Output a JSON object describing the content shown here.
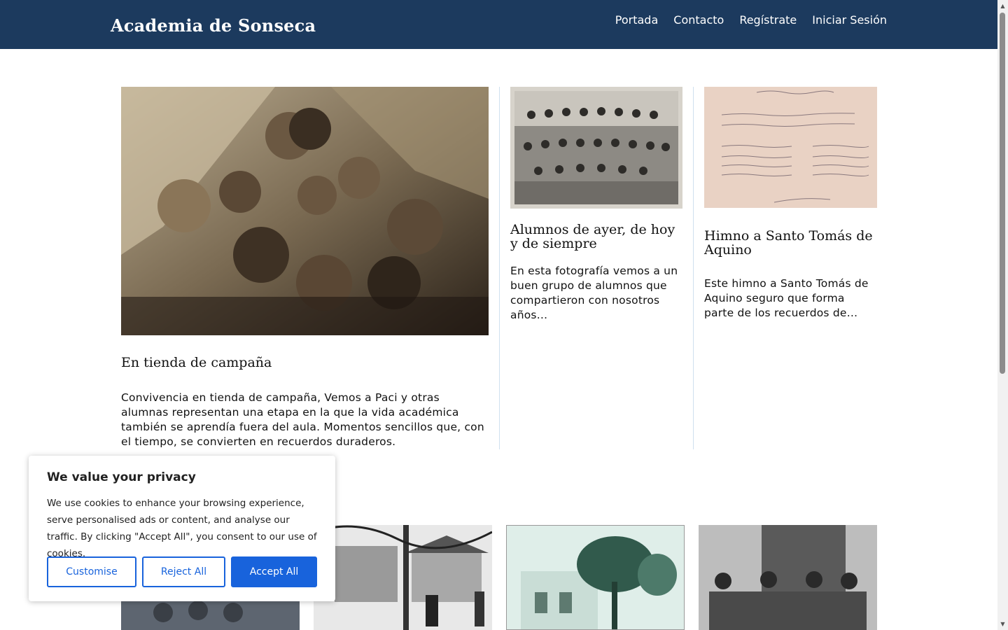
{
  "header": {
    "brand": "Academia de Sonseca",
    "nav": [
      "Portada",
      "Contacto",
      "Regístrate",
      "Iniciar Sesión"
    ]
  },
  "featured": [
    {
      "title": "En tienda de campaña",
      "excerpt": "Convivencia en tienda de campaña, Vemos a Paci y otras alumnas representan una etapa en la que la vida académica también se aprendía fuera del aula. Momentos sencillos que, con el tiempo, se convierten en recuerdos duraderos."
    },
    {
      "title": "Alumnos de ayer, de hoy y de siempre",
      "excerpt": "En esta fotografía vemos a un buen grupo de alumnos que compartieron con nosotros años…"
    },
    {
      "title": "Himno a Santo Tomás de Aquino",
      "excerpt": "Este himno a Santo Tomás de Aquino seguro que forma parte de los recuerdos de…"
    }
  ],
  "cookie": {
    "title": "We value your privacy",
    "text": "We use cookies to enhance your browsing experience, serve personalised ads or content, and analyse our traffic. By clicking \"Accept All\", you consent to our use of cookies.",
    "customise": "Customise",
    "reject": "Reject All",
    "accept": "Accept All"
  },
  "colors": {
    "header_bg": "#1c3a5e",
    "accent": "#1863dc",
    "divider": "#cfe0ef"
  },
  "icons": {
    "scroll_up": "triangle-up",
    "scroll_down": "triangle-down"
  }
}
